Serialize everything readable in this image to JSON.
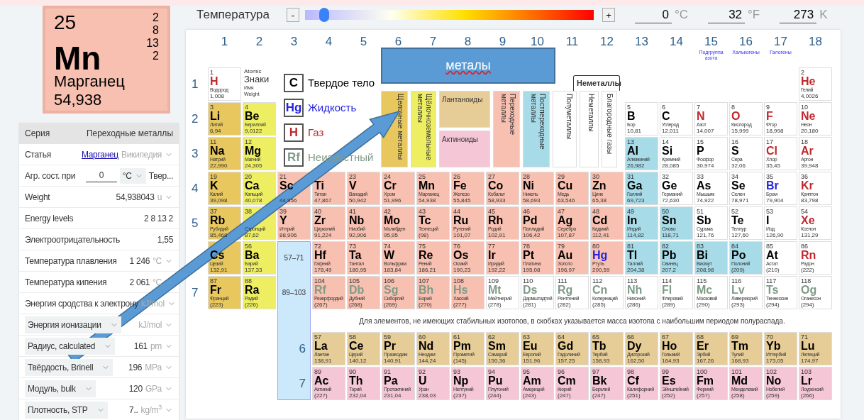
{
  "temperature": {
    "label": "Температура",
    "minus": "-",
    "plus": "+",
    "level": 0.066,
    "readings": [
      {
        "value": "0",
        "unit": "°C"
      },
      {
        "value": "32",
        "unit": "°F"
      },
      {
        "value": "273",
        "unit": "K"
      }
    ]
  },
  "selected_element": {
    "number": "25",
    "symbol": "Mn",
    "name": "Марганец",
    "weight": "54,938",
    "shells": [
      "2",
      "8",
      "13",
      "2"
    ],
    "kind": "transition"
  },
  "properties": [
    {
      "kind": "header",
      "label": "Серия",
      "value": "Переходные металлы"
    },
    {
      "kind": "link",
      "label": "Статья",
      "link": "Марганец",
      "source": "Википедия",
      "dropdown": true
    },
    {
      "kind": "state",
      "label": "Агр. сост. при",
      "input": "0",
      "unit": "°C",
      "value": "Твер..."
    },
    {
      "kind": "value",
      "label": "Weight",
      "label_dropdown": false,
      "value": "54,938043",
      "unit": "u",
      "dropdown": true
    },
    {
      "kind": "value",
      "label": "Energy levels",
      "label_dropdown": false,
      "value": "2 8 13 2",
      "dropdown": false
    },
    {
      "kind": "value",
      "label": "Электроотрицательность",
      "label_dropdown": false,
      "value": "1,55",
      "dropdown": false
    },
    {
      "kind": "value",
      "label": "Температура плавления",
      "label_dropdown": false,
      "value": "1 246",
      "unit": "°C",
      "dropdown": true
    },
    {
      "kind": "value",
      "label": "Температура кипения",
      "label_dropdown": false,
      "value": "2 061",
      "unit": "°C",
      "dropdown": true
    },
    {
      "kind": "value",
      "label": "Энергия сродства к электрону",
      "label_dropdown": false,
      "unit": "kJ/mol",
      "dropdown": true
    },
    {
      "kind": "value",
      "label": "Энергия ионизации",
      "label_dropdown": true,
      "unit": "kJ/mol",
      "dropdown": true
    },
    {
      "kind": "value",
      "label": "Радиус, calculated",
      "label_dropdown": true,
      "value": "161",
      "unit": "pm",
      "dropdown": true
    },
    {
      "kind": "value",
      "label": "Твёрдость, Brinell",
      "label_dropdown": true,
      "value": "196",
      "unit": "MPa",
      "dropdown": true
    },
    {
      "kind": "value",
      "label": "Модуль, bulk",
      "label_dropdown": true,
      "value": "120",
      "unit": "GPa",
      "dropdown": true
    },
    {
      "kind": "value",
      "label": "Плотность, STP",
      "label_dropdown": true,
      "value": "7..",
      "unit": "kg/m$^{3}$",
      "dropdown": true
    }
  ],
  "groups": [
    {
      "label": "1"
    },
    {
      "label": "2"
    },
    {
      "label": "3"
    },
    {
      "label": "4"
    },
    {
      "label": "5"
    },
    {
      "label": "6"
    },
    {
      "label": "7"
    },
    {
      "label": "8"
    },
    {
      "label": "9"
    },
    {
      "label": "10"
    },
    {
      "label": "11"
    },
    {
      "label": "12"
    },
    {
      "label": "13"
    },
    {
      "label": "14"
    },
    {
      "label": "15",
      "subtitle": "Подгруппа азота"
    },
    {
      "label": "16",
      "subtitle": "Халькогены"
    },
    {
      "label": "17",
      "subtitle": "Галогены"
    },
    {
      "label": "18"
    }
  ],
  "key": {
    "number": "Atomic",
    "symbol": "Знаки",
    "name": "Имя",
    "weight": "Weight"
  },
  "state_legend": [
    {
      "symbol": "C",
      "label": "Твердое тело",
      "color": "#000000"
    },
    {
      "symbol": "Hg",
      "label": "Жидкость",
      "color": "#2424e0"
    },
    {
      "symbol": "H",
      "label": "Газ",
      "color": "#c0282d"
    },
    {
      "symbol": "Rf",
      "label": "Неизвестный",
      "color": "#7f9a86"
    }
  ],
  "series_legend": {
    "nonmetal_header": "Неметаллы",
    "items": [
      {
        "kind": "alkali",
        "label": "Щелочные металлы"
      },
      {
        "kind": "alkaline",
        "label": "Щёлочноземельные металлы"
      },
      {
        "kind": "stack",
        "stack": [
          {
            "kind": "lanthanide",
            "label": "Лантаноиды"
          },
          {
            "kind": "actinide",
            "label": "Актиноиды"
          }
        ]
      },
      {
        "kind": "transition",
        "label": "Переходные металлы"
      },
      {
        "kind": "post",
        "label": "Постпереходные металлы"
      },
      {
        "kind": "metalloid",
        "label": "Полуметаллы"
      },
      {
        "kind": "nonmetal",
        "label": "Неметаллы"
      },
      {
        "kind": "noble",
        "label": "Благородные газы"
      }
    ]
  },
  "callout": {
    "text": "металы"
  },
  "periods": [
    {
      "label": "1",
      "elements": [
        {
          "number": "1",
          "symbol": "H",
          "name": "Водород",
          "weight": "1,008",
          "kind": "nonmetal",
          "color": "#c0282d"
        },
        {
          "number": "2",
          "symbol": "He",
          "name": "Гелий",
          "weight": "4,0026",
          "kind": "noble",
          "color": "#c0282d"
        }
      ]
    },
    {
      "label": "2",
      "elements": [
        {
          "number": "3",
          "symbol": "Li",
          "name": "Литий",
          "weight": "6,94",
          "kind": "alkali",
          "color": "#000000"
        },
        {
          "number": "4",
          "symbol": "Be",
          "name": "Бериллий",
          "weight": "9,0122",
          "kind": "alkaline",
          "color": "#000000"
        },
        {
          "number": "5",
          "symbol": "B",
          "name": "Бор",
          "weight": "10,81",
          "kind": "metalloid",
          "color": "#000000"
        },
        {
          "number": "6",
          "symbol": "C",
          "name": "Углерод",
          "weight": "12,011",
          "kind": "nonmetal",
          "color": "#000000"
        },
        {
          "number": "7",
          "symbol": "N",
          "name": "Азот",
          "weight": "14,007",
          "kind": "nonmetal",
          "color": "#c0282d"
        },
        {
          "number": "8",
          "symbol": "O",
          "name": "Кислород",
          "weight": "15,999",
          "kind": "nonmetal",
          "color": "#c0282d"
        },
        {
          "number": "9",
          "symbol": "F",
          "name": "Фтор",
          "weight": "18,998",
          "kind": "nonmetal",
          "color": "#c0282d"
        },
        {
          "number": "10",
          "symbol": "Ne",
          "name": "Неон",
          "weight": "20,180",
          "kind": "noble",
          "color": "#c0282d"
        }
      ]
    },
    {
      "label": "3",
      "elements": [
        {
          "number": "11",
          "symbol": "Na",
          "name": "Натрий",
          "weight": "22,990",
          "kind": "alkali",
          "color": "#000000"
        },
        {
          "number": "12",
          "symbol": "Mg",
          "name": "Магний",
          "weight": "24,305",
          "kind": "alkaline",
          "color": "#000000"
        },
        {
          "number": "13",
          "symbol": "Al",
          "name": "Алюминий",
          "weight": "26,982",
          "kind": "post",
          "color": "#000000"
        },
        {
          "number": "14",
          "symbol": "Si",
          "name": "Кремний",
          "weight": "28,085",
          "kind": "metalloid",
          "color": "#000000"
        },
        {
          "number": "15",
          "symbol": "P",
          "name": "Фосфор",
          "weight": "30,974",
          "kind": "nonmetal",
          "color": "#000000"
        },
        {
          "number": "16",
          "symbol": "S",
          "name": "Сера",
          "weight": "32,06",
          "kind": "nonmetal",
          "color": "#000000"
        },
        {
          "number": "17",
          "symbol": "Cl",
          "name": "Хлор",
          "weight": "35,45",
          "kind": "nonmetal",
          "color": "#c0282d"
        },
        {
          "number": "18",
          "symbol": "Ar",
          "name": "Аргон",
          "weight": "39,948",
          "kind": "noble",
          "color": "#c0282d"
        }
      ]
    },
    {
      "label": "4",
      "elements": [
        {
          "number": "19",
          "symbol": "K",
          "name": "Калий",
          "weight": "39,098",
          "kind": "alkali",
          "color": "#000000"
        },
        {
          "number": "20",
          "symbol": "Ca",
          "name": "Кальций",
          "weight": "40,078",
          "kind": "alkaline",
          "color": "#000000"
        },
        {
          "number": "21",
          "symbol": "Sc",
          "weight": "44,956",
          "kind": "transition",
          "color": "#000000"
        },
        {
          "symbol": "Ti",
          "name": "Титан",
          "weight": "47,867",
          "kind": "transition",
          "color": "#000000"
        },
        {
          "number": "23",
          "symbol": "V",
          "name": "Ванадий",
          "weight": "50,942",
          "kind": "transition",
          "color": "#000000"
        },
        {
          "number": "24",
          "symbol": "Cr",
          "name": "Хром",
          "weight": "51,996",
          "kind": "transition",
          "color": "#000000"
        },
        {
          "number": "25",
          "symbol": "Mn",
          "name": "Марганец",
          "weight": "54,938",
          "kind": "transition",
          "color": "#000000"
        },
        {
          "number": "26",
          "symbol": "Fe",
          "name": "Железо",
          "weight": "55,845",
          "kind": "transition",
          "color": "#000000"
        },
        {
          "number": "27",
          "symbol": "Co",
          "name": "Кобальт",
          "weight": "58,933",
          "kind": "transition",
          "color": "#000000"
        },
        {
          "number": "28",
          "symbol": "Ni",
          "name": "Никель",
          "weight": "58,693",
          "kind": "transition",
          "color": "#000000"
        },
        {
          "number": "29",
          "symbol": "Cu",
          "name": "Медь",
          "weight": "63,546",
          "kind": "transition",
          "color": "#000000"
        },
        {
          "number": "30",
          "symbol": "Zn",
          "name": "Цинк",
          "weight": "65,38",
          "kind": "transition",
          "color": "#000000"
        },
        {
          "number": "31",
          "symbol": "Ga",
          "name": "Галлий",
          "weight": "69,723",
          "kind": "post",
          "color": "#000000"
        },
        {
          "number": "32",
          "symbol": "Ge",
          "name": "Германий",
          "weight": "72,630",
          "kind": "metalloid",
          "color": "#000000"
        },
        {
          "number": "33",
          "symbol": "As",
          "name": "Мышьяк",
          "weight": "74,922",
          "kind": "metalloid",
          "color": "#000000"
        },
        {
          "number": "34",
          "symbol": "Se",
          "name": "Селен",
          "weight": "78,971",
          "kind": "nonmetal",
          "color": "#000000"
        },
        {
          "number": "35",
          "symbol": "Br",
          "name": "Бром",
          "weight": "79,904",
          "kind": "nonmetal",
          "color": "#2424e0"
        },
        {
          "number": "36",
          "symbol": "Kr",
          "name": "Криптон",
          "weight": "83,798",
          "kind": "noble",
          "color": "#c0282d"
        }
      ]
    },
    {
      "label": "5",
      "elements": [
        {
          "number": "37",
          "symbol": "Rb",
          "name": "Рубидий",
          "weight": "85,468",
          "kind": "alkali",
          "color": "#000000"
        },
        {
          "number": "38",
          "name": "Стронций",
          "weight": "87,62",
          "kind": "alkaline"
        },
        {
          "number": "39",
          "symbol": "Y",
          "name": "Иттрий",
          "weight": "88,906",
          "kind": "transition",
          "color": "#000000"
        },
        {
          "number": "40",
          "symbol": "Zr",
          "name": "Цирконий",
          "weight": "91,224",
          "kind": "transition",
          "color": "#000000"
        },
        {
          "number": "41",
          "symbol": "Nb",
          "name": "Ниобий",
          "weight": "92,906",
          "kind": "transition",
          "color": "#000000"
        },
        {
          "number": "42",
          "symbol": "Mo",
          "name": "Молибден",
          "weight": "95,95",
          "kind": "transition",
          "color": "#000000"
        },
        {
          "number": "43",
          "symbol": "Tc",
          "name": "Технеций",
          "weight": "(98)",
          "kind": "transition",
          "color": "#000000"
        },
        {
          "number": "44",
          "symbol": "Ru",
          "name": "Рутений",
          "weight": "101,07",
          "kind": "transition",
          "color": "#000000"
        },
        {
          "number": "45",
          "symbol": "Rh",
          "name": "Родий",
          "weight": "102,91",
          "kind": "transition",
          "color": "#000000"
        },
        {
          "number": "46",
          "symbol": "Pd",
          "name": "Палладий",
          "weight": "106,42",
          "kind": "transition",
          "color": "#000000"
        },
        {
          "number": "47",
          "symbol": "Ag",
          "name": "Серебро",
          "weight": "107,87",
          "kind": "transition",
          "color": "#000000"
        },
        {
          "number": "48",
          "symbol": "Cd",
          "name": "Кадмий",
          "weight": "112,41",
          "kind": "transition",
          "color": "#000000"
        },
        {
          "number": "49",
          "symbol": "In",
          "name": "Индий",
          "weight": "114,82",
          "kind": "post",
          "color": "#000000"
        },
        {
          "number": "50",
          "symbol": "Sn",
          "name": "Олово",
          "weight": "118,71",
          "kind": "post",
          "color": "#000000"
        },
        {
          "number": "51",
          "symbol": "Sb",
          "name": "Сурьма",
          "weight": "121,76",
          "kind": "metalloid",
          "color": "#000000"
        },
        {
          "number": "52",
          "symbol": "Te",
          "name": "Теллур",
          "weight": "127,60",
          "kind": "metalloid",
          "color": "#000000"
        },
        {
          "number": "53",
          "symbol": "I",
          "name": "Иод",
          "weight": "126,90",
          "kind": "nonmetal",
          "color": "#000000"
        },
        {
          "number": "54",
          "symbol": "Xe",
          "name": "Ксенон",
          "weight": "131,29",
          "kind": "noble",
          "color": "#c0282d"
        }
      ]
    },
    {
      "range": "57–71",
      "elements": [
        {
          "symbol": "Cs",
          "name": "Цезий",
          "weight": "132,91",
          "kind": "alkali",
          "color": "#000000"
        },
        {
          "number": "56",
          "symbol": "Ba",
          "name": "Барий",
          "weight": "137,33",
          "kind": "alkaline",
          "color": "#000000"
        },
        {
          "number": "72",
          "symbol": "Hf",
          "name": "Гафний",
          "weight": "178,49",
          "kind": "transition",
          "color": "#000000"
        },
        {
          "number": "73",
          "symbol": "Ta",
          "name": "Тантал",
          "weight": "180,95",
          "kind": "transition",
          "color": "#000000"
        },
        {
          "number": "74",
          "symbol": "W",
          "name": "Вольфрам",
          "weight": "183,84",
          "kind": "transition",
          "color": "#000000"
        },
        {
          "number": "75",
          "symbol": "Re",
          "name": "Рений",
          "weight": "186,21",
          "kind": "transition",
          "color": "#000000"
        },
        {
          "number": "76",
          "symbol": "Os",
          "name": "Осмий",
          "weight": "190,23",
          "kind": "transition",
          "color": "#000000"
        },
        {
          "number": "77",
          "symbol": "Ir",
          "name": "Иридий",
          "weight": "192,22",
          "kind": "transition",
          "color": "#000000"
        },
        {
          "number": "78",
          "symbol": "Pt",
          "name": "Платина",
          "weight": "195,08",
          "kind": "transition",
          "color": "#000000"
        },
        {
          "number": "79",
          "symbol": "Au",
          "name": "Золото",
          "weight": "196,97",
          "kind": "transition",
          "color": "#000000"
        },
        {
          "number": "80",
          "symbol": "Hg",
          "name": "Ртуть",
          "weight": "200,59",
          "kind": "transition",
          "color": "#2424e0"
        },
        {
          "number": "81",
          "symbol": "Tl",
          "name": "Таллий",
          "weight": "204,38",
          "kind": "post",
          "color": "#000000"
        },
        {
          "number": "82",
          "symbol": "Pb",
          "name": "Свинец",
          "weight": "207,2",
          "kind": "post",
          "color": "#000000"
        },
        {
          "number": "83",
          "symbol": "Bi",
          "name": "Висмут",
          "weight": "208,98",
          "kind": "post",
          "color": "#000000"
        },
        {
          "number": "84",
          "symbol": "Po",
          "name": "Полоний",
          "weight": "(209)",
          "kind": "post",
          "color": "#000000"
        },
        {
          "number": "85",
          "symbol": "At",
          "name": "Астат",
          "weight": "(210)",
          "kind": "metalloid",
          "color": "#000000"
        },
        {
          "number": "86",
          "symbol": "Rn",
          "name": "Радон",
          "weight": "(222)",
          "kind": "noble",
          "color": "#c0282d"
        }
      ]
    },
    {
      "label": "7",
      "range": "89–103",
      "elements": [
        {
          "number": "87",
          "symbol": "Fr",
          "name": "Франций",
          "weight": "(223)",
          "kind": "alkali",
          "color": "#000000"
        },
        {
          "number": "88",
          "symbol": "Ra",
          "name": "Радий",
          "weight": "(226)",
          "kind": "alkaline",
          "color": "#000000"
        },
        {
          "number": "104",
          "symbol": "Rf",
          "name": "Резерфордий",
          "weight": "(267)",
          "kind": "transition",
          "color": "#7f9a86"
        },
        {
          "number": "105",
          "symbol": "Db",
          "name": "Дубний",
          "weight": "(268)",
          "kind": "transition",
          "color": "#7f9a86"
        },
        {
          "number": "106",
          "symbol": "Sg",
          "name": "Сиборгий",
          "weight": "(269)",
          "kind": "transition",
          "color": "#7f9a86"
        },
        {
          "number": "107",
          "symbol": "Bh",
          "name": "Борий",
          "weight": "(270)",
          "kind": "transition",
          "color": "#7f9a86"
        },
        {
          "number": "108",
          "symbol": "Hs",
          "name": "Хассий",
          "weight": "(277)",
          "kind": "transition",
          "color": "#7f9a86"
        },
        {
          "number": "109",
          "symbol": "Mt",
          "name": "Мейтнерий",
          "weight": "(278)",
          "kind": "unknown",
          "color": "#7f9a86"
        },
        {
          "number": "110",
          "symbol": "Ds",
          "name": "Дармштадтий",
          "weight": "(281)",
          "kind": "unknown",
          "color": "#7f9a86"
        },
        {
          "number": "111",
          "symbol": "Rg",
          "name": "Рентгений",
          "weight": "(282)",
          "kind": "unknown",
          "color": "#7f9a86"
        },
        {
          "number": "112",
          "symbol": "Cn",
          "name": "Коперниций",
          "weight": "(285)",
          "kind": "unknown",
          "color": "#7f9a86"
        },
        {
          "number": "113",
          "symbol": "Nh",
          "name": "Нихоний",
          "weight": "(286)",
          "kind": "unknown",
          "color": "#7f9a86"
        },
        {
          "number": "114",
          "symbol": "Fl",
          "name": "Флеровий",
          "weight": "(289)",
          "kind": "unknown",
          "color": "#7f9a86"
        },
        {
          "number": "115",
          "symbol": "Mc",
          "name": "Московий",
          "weight": "(290)",
          "kind": "unknown",
          "color": "#7f9a86"
        },
        {
          "number": "116",
          "symbol": "Lv",
          "name": "Ливерморий",
          "weight": "(293)",
          "kind": "unknown",
          "color": "#7f9a86"
        },
        {
          "number": "117",
          "symbol": "Ts",
          "name": "Теннессин",
          "weight": "(294)",
          "kind": "unknown",
          "color": "#7f9a86"
        },
        {
          "number": "118",
          "symbol": "Og",
          "name": "Оганесон",
          "weight": "(294)",
          "kind": "unknown",
          "color": "#7f9a86"
        }
      ]
    }
  ],
  "note": "Для элементов, не имеющих стабильных изотопов, в скобках указывается масса изотопа с наибольшим периодом полураспада.",
  "f_block": [
    {
      "label": "6",
      "elements": [
        {
          "number": "57",
          "symbol": "La",
          "name": "Лантан",
          "weight": "138,91",
          "kind": "lanthanide",
          "color": "#000000"
        },
        {
          "number": "58",
          "symbol": "Ce",
          "name": "Церий",
          "weight": "140,12",
          "kind": "lanthanide",
          "color": "#000000"
        },
        {
          "number": "59",
          "symbol": "Pr",
          "name": "Празеодим",
          "weight": "140,91",
          "kind": "lanthanide",
          "color": "#000000"
        },
        {
          "number": "60",
          "symbol": "Nd",
          "name": "Неодим",
          "weight": "144,24",
          "kind": "lanthanide",
          "color": "#000000"
        },
        {
          "number": "61",
          "symbol": "Pm",
          "name": "Прометий",
          "weight": "(145)",
          "kind": "lanthanide",
          "color": "#000000"
        },
        {
          "number": "62",
          "symbol": "Sm",
          "name": "Самарий",
          "weight": "150,36",
          "kind": "lanthanide",
          "color": "#000000"
        },
        {
          "number": "63",
          "symbol": "Eu",
          "name": "Европий",
          "weight": "151,96",
          "kind": "lanthanide",
          "color": "#000000"
        },
        {
          "number": "64",
          "symbol": "Gd",
          "name": "Гадолиний",
          "weight": "157,25",
          "kind": "lanthanide",
          "color": "#000000"
        },
        {
          "number": "65",
          "symbol": "Tb",
          "name": "Тербий",
          "weight": "158,93",
          "kind": "lanthanide",
          "color": "#000000"
        },
        {
          "number": "66",
          "symbol": "Dy",
          "name": "Диспрозий",
          "weight": "162,50",
          "kind": "lanthanide",
          "color": "#000000"
        },
        {
          "number": "67",
          "symbol": "Ho",
          "name": "Гольмий",
          "weight": "164,93",
          "kind": "lanthanide",
          "color": "#000000"
        },
        {
          "number": "68",
          "symbol": "Er",
          "name": "Эрбий",
          "weight": "167,26",
          "kind": "lanthanide",
          "color": "#000000"
        },
        {
          "number": "69",
          "symbol": "Tm",
          "name": "Тулий",
          "weight": "168,93",
          "kind": "lanthanide",
          "color": "#000000"
        },
        {
          "number": "70",
          "symbol": "Yb",
          "name": "Иттербий",
          "weight": "173,05",
          "kind": "lanthanide",
          "color": "#000000"
        },
        {
          "number": "71",
          "symbol": "Lu",
          "name": "Лютеций",
          "weight": "174,97",
          "kind": "lanthanide",
          "color": "#000000"
        }
      ]
    },
    {
      "label": "7",
      "elements": [
        {
          "number": "89",
          "symbol": "Ac",
          "name": "Актиний",
          "weight": "(227)",
          "kind": "actinide",
          "color": "#000000"
        },
        {
          "number": "90",
          "symbol": "Th",
          "name": "Торий",
          "weight": "232,04",
          "kind": "actinide",
          "color": "#000000"
        },
        {
          "number": "91",
          "symbol": "Pa",
          "name": "Протактиний",
          "weight": "231,04",
          "kind": "actinide",
          "color": "#000000"
        },
        {
          "number": "92",
          "symbol": "U",
          "name": "Уран",
          "weight": "238,03",
          "kind": "actinide",
          "color": "#000000"
        },
        {
          "number": "93",
          "symbol": "Np",
          "name": "Нептуний",
          "weight": "(237)",
          "kind": "actinide",
          "color": "#000000"
        },
        {
          "number": "94",
          "symbol": "Pu",
          "name": "Плутоний",
          "weight": "(244)",
          "kind": "actinide",
          "color": "#000000"
        },
        {
          "number": "95",
          "symbol": "Am",
          "name": "Америций",
          "weight": "(243)",
          "kind": "actinide",
          "color": "#000000"
        },
        {
          "number": "96",
          "symbol": "Cm",
          "name": "Кюрий",
          "weight": "(247)",
          "kind": "actinide",
          "color": "#000000"
        },
        {
          "number": "97",
          "symbol": "Bk",
          "name": "Берклий",
          "weight": "(247)",
          "kind": "actinide",
          "color": "#000000"
        },
        {
          "number": "98",
          "symbol": "Cf",
          "name": "Калифорний",
          "weight": "(251)",
          "kind": "actinide",
          "color": "#000000"
        },
        {
          "number": "99",
          "symbol": "Es",
          "name": "Эйнштейний",
          "weight": "(252)",
          "kind": "actinide",
          "color": "#000000"
        },
        {
          "number": "100",
          "symbol": "Fm",
          "name": "Фермий",
          "weight": "(257)",
          "kind": "actinide",
          "color": "#000000"
        },
        {
          "number": "101",
          "symbol": "Md",
          "name": "Менделевий",
          "weight": "(258)",
          "kind": "actinide",
          "color": "#000000"
        },
        {
          "number": "102",
          "symbol": "No",
          "name": "Нобелий",
          "weight": "(259)",
          "kind": "actinide",
          "color": "#000000"
        },
        {
          "number": "103",
          "symbol": "Lr",
          "name": "Лоуренсий",
          "weight": "(266)",
          "kind": "actinide",
          "color": "#000000"
        }
      ]
    }
  ]
}
